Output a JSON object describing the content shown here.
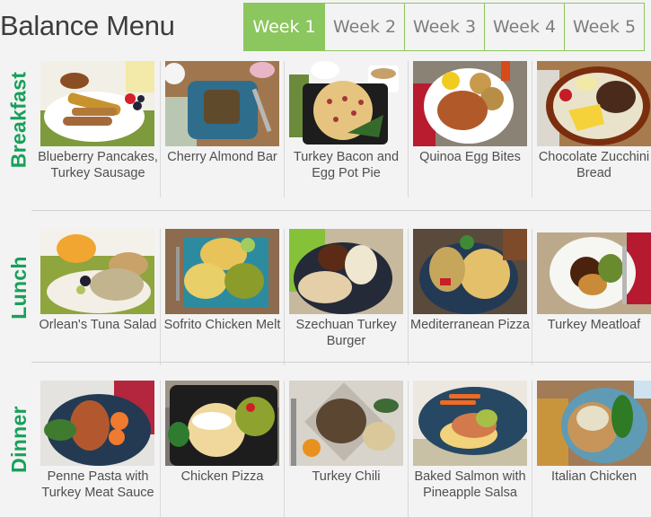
{
  "header": {
    "title": "Balance Menu",
    "tabs": [
      {
        "label": "Week 1",
        "active": true
      },
      {
        "label": "Week 2",
        "active": false
      },
      {
        "label": "Week 3",
        "active": false
      },
      {
        "label": "Week 4",
        "active": false
      },
      {
        "label": "Week 5",
        "active": false
      }
    ]
  },
  "colors": {
    "accent": "#8cc65f",
    "section_label": "#18a05a",
    "background": "#f3f3f3",
    "text": "#4f4f4f"
  },
  "sections": [
    {
      "label": "Breakfast",
      "items": [
        {
          "name": "Blueberry Pancakes, Turkey Sausage",
          "image": "pancakes-photo"
        },
        {
          "name": "Cherry Almond Bar",
          "image": "almond-bar-photo"
        },
        {
          "name": "Turkey Bacon and Egg Pot Pie",
          "image": "pot-pie-photo"
        },
        {
          "name": "Quinoa Egg Bites",
          "image": "egg-bites-photo"
        },
        {
          "name": "Chocolate Zucchini Bread",
          "image": "zucchini-bread-photo"
        }
      ]
    },
    {
      "label": "Lunch",
      "items": [
        {
          "name": "Orlean's Tuna Salad",
          "image": "tuna-salad-photo"
        },
        {
          "name": "Sofrito Chicken Melt",
          "image": "chicken-melt-photo"
        },
        {
          "name": "Szechuan Turkey Burger",
          "image": "turkey-burger-photo"
        },
        {
          "name": "Mediterranean Pizza",
          "image": "mediterranean-pizza-photo"
        },
        {
          "name": "Turkey Meatloaf",
          "image": "meatloaf-photo"
        }
      ]
    },
    {
      "label": "Dinner",
      "items": [
        {
          "name": "Penne Pasta with Turkey Meat Sauce",
          "image": "penne-pasta-photo"
        },
        {
          "name": "Chicken Pizza",
          "image": "chicken-pizza-photo"
        },
        {
          "name": "Turkey Chili",
          "image": "turkey-chili-photo"
        },
        {
          "name": "Baked Salmon with Pineapple Salsa",
          "image": "salmon-photo"
        },
        {
          "name": "Italian Chicken",
          "image": "italian-chicken-photo"
        }
      ]
    }
  ]
}
